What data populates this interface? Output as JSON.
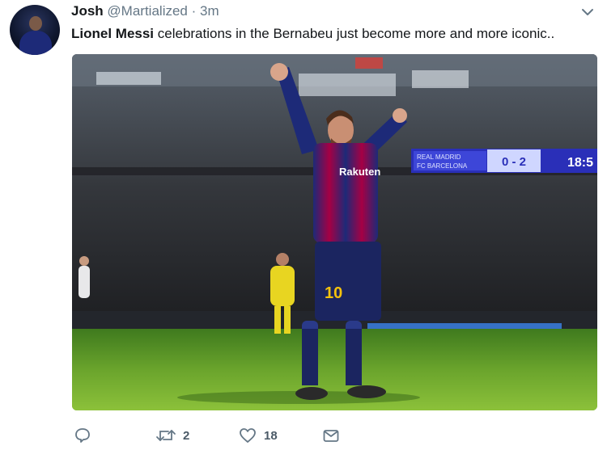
{
  "tweet": {
    "author_name": "Josh",
    "author_handle": "@Martialized",
    "separator": "·",
    "time": "3m",
    "text_bold": "Lionel Messi",
    "text_rest": " celebrations in the Bernabeu just become more and more iconic..",
    "media": {
      "shirt_sponsor": "Rakuten",
      "shirt_number": "10",
      "scoreboard_score": "0 - 2",
      "scoreboard_time": "18:5",
      "scoreboard_teams": [
        "REAL MADRID",
        "FC BARCELONA"
      ]
    },
    "actions": {
      "reply_icon": "reply-icon",
      "retweet_icon": "retweet-icon",
      "retweet_count": "2",
      "like_icon": "heart-icon",
      "like_count": "18",
      "dm_icon": "envelope-icon"
    }
  },
  "colors": {
    "text": "#14171a",
    "muted": "#657786",
    "barca_blue": "#1d2a78",
    "barca_red": "#a50044"
  }
}
